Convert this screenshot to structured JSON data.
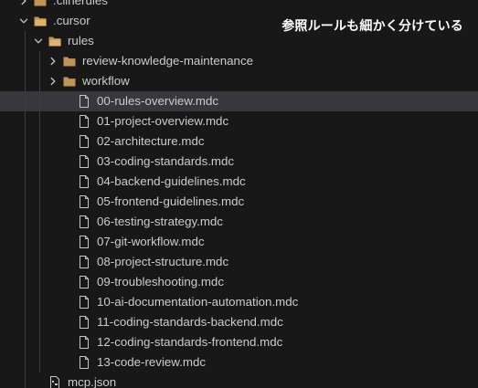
{
  "explorer": {
    "items": [
      {
        "label": ".clinerules",
        "type": "folder",
        "state": "collapsed",
        "depth": 0
      },
      {
        "label": ".cursor",
        "type": "folder",
        "state": "expanded",
        "depth": 0
      },
      {
        "label": "rules",
        "type": "folder",
        "state": "expanded",
        "depth": 1
      },
      {
        "label": "review-knowledge-maintenance",
        "type": "folder",
        "state": "collapsed",
        "depth": 2
      },
      {
        "label": "workflow",
        "type": "folder",
        "state": "collapsed",
        "depth": 2
      },
      {
        "label": "00-rules-overview.mdc",
        "type": "file",
        "depth": 2,
        "selected": true
      },
      {
        "label": "01-project-overview.mdc",
        "type": "file",
        "depth": 2
      },
      {
        "label": "02-architecture.mdc",
        "type": "file",
        "depth": 2
      },
      {
        "label": "03-coding-standards.mdc",
        "type": "file",
        "depth": 2
      },
      {
        "label": "04-backend-guidelines.mdc",
        "type": "file",
        "depth": 2
      },
      {
        "label": "05-frontend-guidelines.mdc",
        "type": "file",
        "depth": 2
      },
      {
        "label": "06-testing-strategy.mdc",
        "type": "file",
        "depth": 2
      },
      {
        "label": "07-git-workflow.mdc",
        "type": "file",
        "depth": 2
      },
      {
        "label": "08-project-structure.mdc",
        "type": "file",
        "depth": 2
      },
      {
        "label": "09-troubleshooting.mdc",
        "type": "file",
        "depth": 2
      },
      {
        "label": "10-ai-documentation-automation.mdc",
        "type": "file",
        "depth": 2
      },
      {
        "label": "11-coding-standards-backend.mdc",
        "type": "file",
        "depth": 2
      },
      {
        "label": "12-coding-standards-frontend.mdc",
        "type": "file",
        "depth": 2
      },
      {
        "label": "13-code-review.mdc",
        "type": "file",
        "depth": 2
      },
      {
        "label": "mcp.json",
        "type": "json-file",
        "depth": 1
      }
    ]
  },
  "annotation": {
    "text": "参照ルールも細かく分けている"
  },
  "icons": {
    "folder": "folder-icon",
    "file": "file-icon",
    "json": "json-file-icon",
    "chevron_collapsed": "chevron-right-icon",
    "chevron_expanded": "chevron-down-icon"
  },
  "colors": {
    "background": "#181818",
    "selected_row": "#37373d",
    "folder": "#c09553",
    "text": "#cccccc",
    "annotation": "#ffffff"
  }
}
